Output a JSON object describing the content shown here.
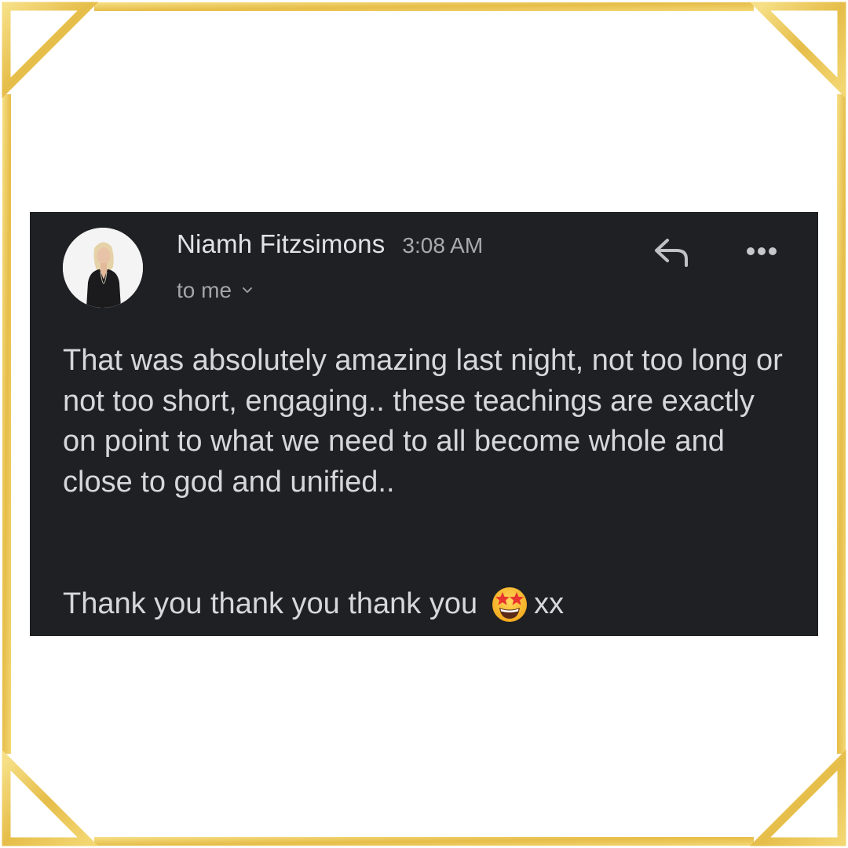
{
  "colors": {
    "gold": "#e9c350",
    "gold_light": "#f6e08a",
    "card_bg": "#1f2023",
    "text": "#d6d7da",
    "muted": "#a3a5a9"
  },
  "email": {
    "sender_name": "Niamh Fitzsimons",
    "time": "3:08 AM",
    "recipient": "to me",
    "avatar_icon": "person-photo",
    "reply_icon": "reply-arrow",
    "more_icon": "ellipsis",
    "body": "That was absolutely amazing last night, not too long or not too short, engaging.. these teachings are exactly on point to what we need to all become whole and close to god and unified..",
    "closing_text": "Thank you thank you thank you",
    "closing_emoji": "star-struck-face",
    "closing_suffix": "xx"
  }
}
